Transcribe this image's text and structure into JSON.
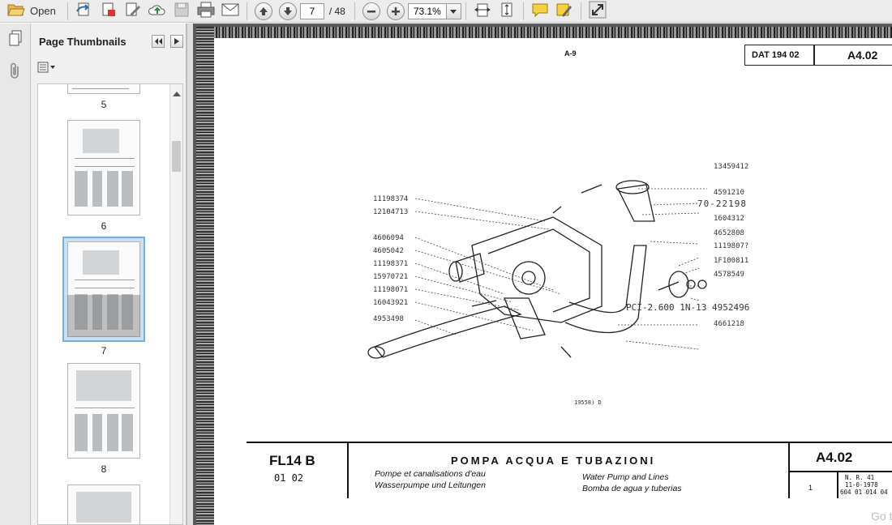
{
  "toolbar": {
    "open_label": "Open",
    "current_page": "7",
    "total_pages": "/ 48",
    "zoom": "73.1%",
    "icons": [
      "folder-open-icon",
      "share-icon",
      "create-pdf-icon",
      "edit-icon",
      "upload-cloud-icon",
      "save-icon",
      "print-icon",
      "email-icon",
      "page-up-icon",
      "page-down-icon",
      "zoom-out-icon",
      "zoom-in-icon",
      "fit-width-icon",
      "fit-page-icon",
      "comment-icon",
      "highlight-icon",
      "fullscreen-icon"
    ]
  },
  "sidebar": {
    "title": "Page Thumbnails",
    "thumbnails": [
      {
        "label": "5"
      },
      {
        "label": "6"
      },
      {
        "label": "7",
        "selected": true
      },
      {
        "label": "8"
      }
    ]
  },
  "document": {
    "top_center": "A-9",
    "header_code": "DAT 194 02",
    "header_ref": "A4.02",
    "part_numbers": [
      "13459412",
      "4591210",
      "70-22198",
      "1604312",
      "4652808",
      "1119807?",
      "1F100811",
      "4578549",
      "11198374",
      "12104713",
      "4606094",
      "4605042",
      "11198371",
      "15970721",
      "11198071",
      "16043921",
      "4953498",
      "PCI-2.600 1N-13 4952496",
      "4661218"
    ],
    "figure_caption": "19558) D",
    "model": "FL14 B",
    "model_sub": "01   02",
    "title_it": "POMPA ACQUA E TUBAZIONI",
    "title_fr": "Pompe et canalisations d'eau",
    "title_de": "Wasserpumpe und Leitungen",
    "title_en": "Water Pump and Lines",
    "title_es": "Bomba de agua y tuberias",
    "ref_big": "A4.02",
    "ref_index": "1",
    "ref_lines": [
      "N. R. 41",
      "11-0-1978",
      "604 01 014 04"
    ],
    "watermark": "Go t"
  }
}
